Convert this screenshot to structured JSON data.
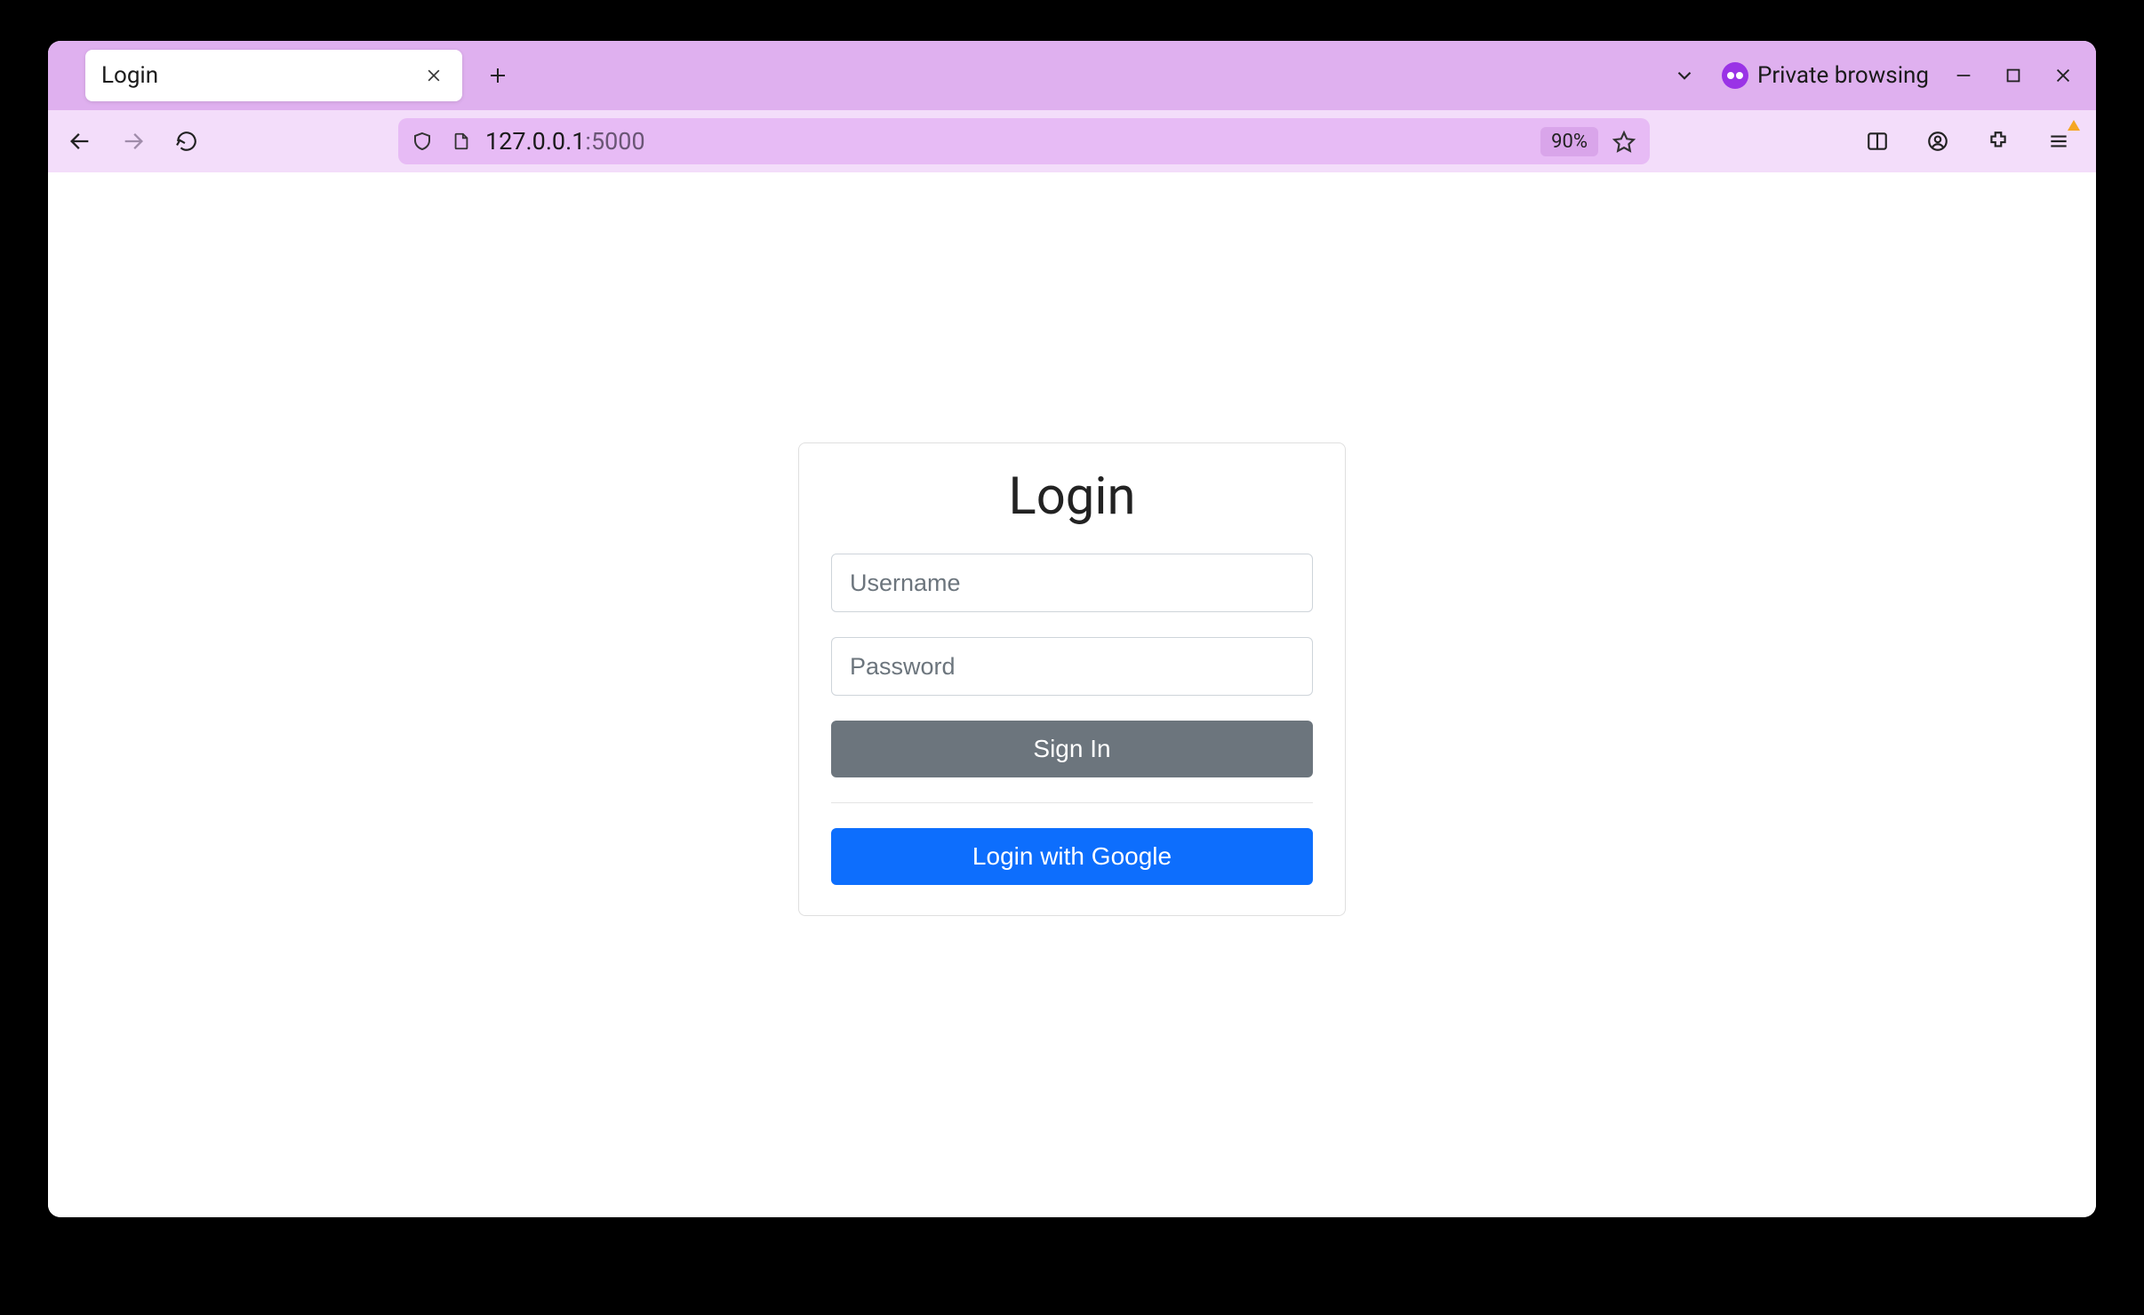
{
  "browser": {
    "tab": {
      "title": "Login"
    },
    "private_label": "Private browsing",
    "address": {
      "host": "127.0.0.1",
      "port": ":5000"
    },
    "zoom": "90%"
  },
  "login": {
    "title": "Login",
    "username_placeholder": "Username",
    "password_placeholder": "Password",
    "signin_label": "Sign In",
    "google_label": "Login with Google"
  }
}
